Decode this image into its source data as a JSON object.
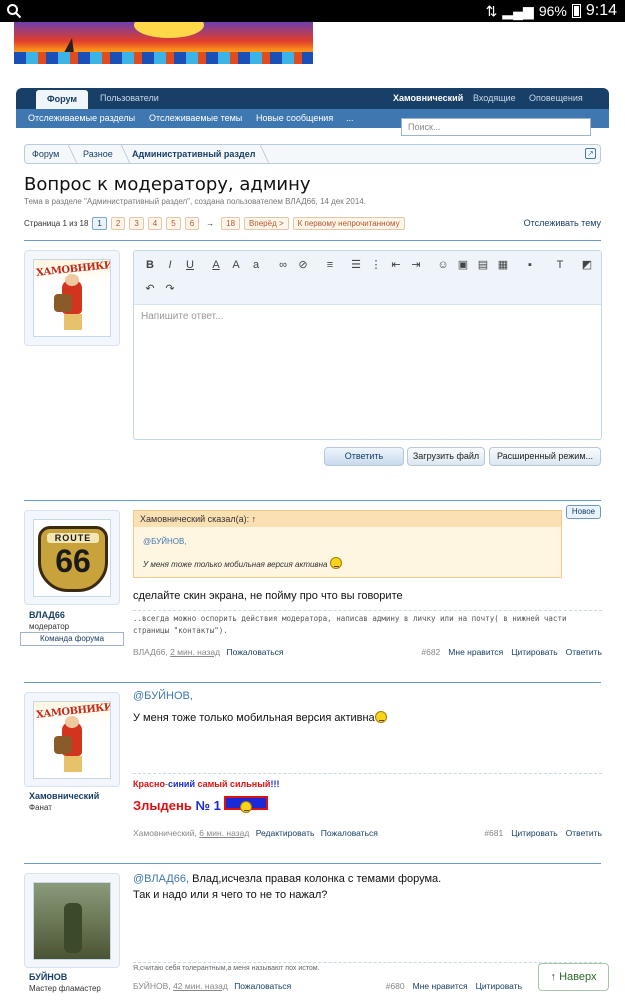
{
  "status_bar": {
    "battery": "96%",
    "time": "9:14"
  },
  "nav": {
    "active_tab": "Форум",
    "tabs": [
      "Пользователи"
    ],
    "user_links": [
      "Хамовнический",
      "Входящие",
      "Оповещения"
    ],
    "sub_links": [
      "Отслеживаемые разделы",
      "Отслеживаемые темы",
      "Новые сообщения",
      "..."
    ],
    "search_placeholder": "Поиск..."
  },
  "breadcrumb": [
    "Форум",
    "Разное",
    "Административный раздел"
  ],
  "thread": {
    "title": "Вопрос к модератору, админу",
    "subtitle": "Тема в разделе \"Административный раздел\", создана пользователем ВЛАД66, 14 дек 2014.",
    "page_info": "Страница 1 из 18",
    "pages": [
      "1",
      "2",
      "3",
      "4",
      "5",
      "6"
    ],
    "arrow": "→",
    "last_page": "18",
    "next_label": "Вперёд >",
    "first_unread_label": "К первому непрочитанному",
    "watch_label": "Отслеживать тему"
  },
  "editor": {
    "placeholder": "Напишите ответ...",
    "reply_button": "Ответить",
    "upload_button": "Загрузить файл",
    "advanced_button": "Расширенный режим..."
  },
  "posts": [
    {
      "author": "ВЛАД66",
      "role": "модератор",
      "team": "Команда форума",
      "new_badge": "Новое",
      "quote_header": "Хамовнический сказал(а): ↑",
      "quote_line1": "@БУЙНОВ,",
      "quote_line2": "У меня тоже только мобильная версия активна",
      "text": "сделайте скин экрана, не пойму про что вы говорите",
      "signature": "..всегда можно оспорить действия модератора, написав админу в личку или на почту( в нижней части страницы \"контакты\").",
      "meta_author": "ВЛАД66,",
      "meta_time": "2 мин. назад",
      "report": "Пожаловаться",
      "number": "#682",
      "like": "Мне нравится",
      "quote_btn": "Цитировать",
      "reply_btn": "Ответить"
    },
    {
      "author": "Хамовнический",
      "role": "Фанат",
      "mention": "@БУЙНОВ,",
      "text": "У меня тоже только мобильная версия активна",
      "sig_red": "Красно",
      "sig_dash": "-",
      "sig_blue": "синий",
      "sig_red2": "самый сильный",
      "sig_exc": "!!!",
      "sig_line2_red": "Злыдень",
      "sig_line2_blue": "№ 1",
      "meta_author": "Хамовнический,",
      "meta_time": "6 мин. назад",
      "edit": "Редактировать",
      "report": "Пожаловаться",
      "number": "#681",
      "quote_btn": "Цитировать",
      "reply_btn": "Ответить"
    },
    {
      "author": "БУЙНОВ",
      "role": "Мастер фламастер",
      "mention": "@ВЛАД66,",
      "text1": "Влад,исчезла правая колонка с темами форума.",
      "text2": "Так и надо или я чего то не то нажал?",
      "signature": "Я,считаю себя толерантным,а меня называют пох истом.",
      "meta_author": "БУЙНОВ,",
      "meta_time": "42 мин. назад",
      "report": "Пожаловаться",
      "number": "#680",
      "like": "Мне нравится",
      "quote_btn": "Цитировать"
    }
  ],
  "back_to_top": "↑ Наверх"
}
